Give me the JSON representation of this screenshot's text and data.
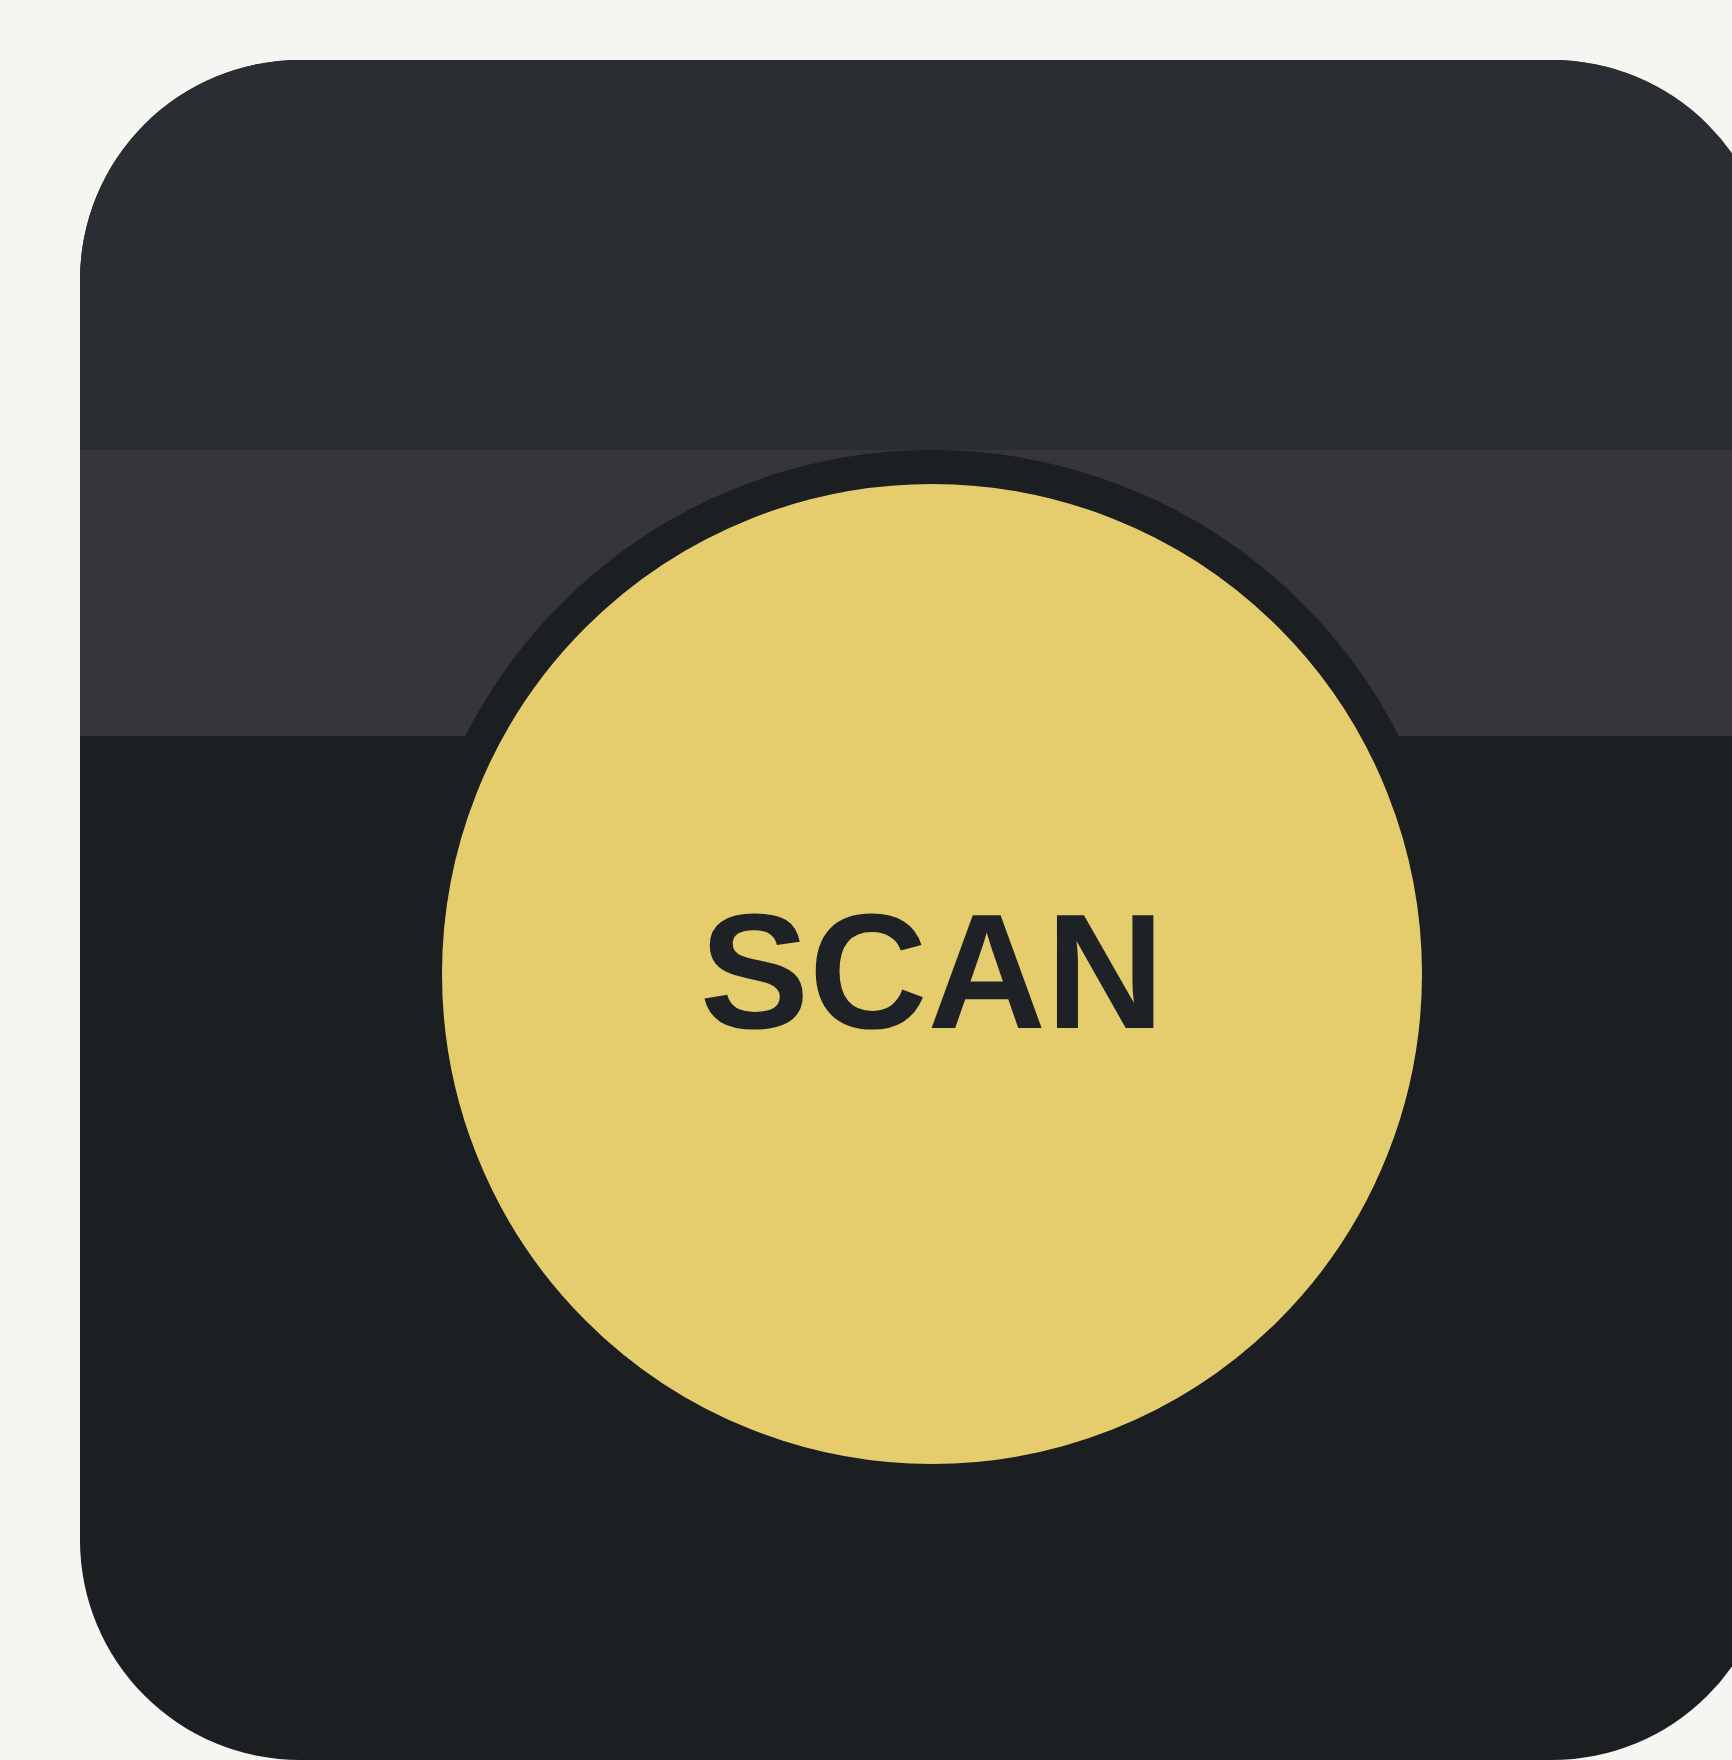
{
  "scan_button": {
    "label": "SCAN"
  }
}
